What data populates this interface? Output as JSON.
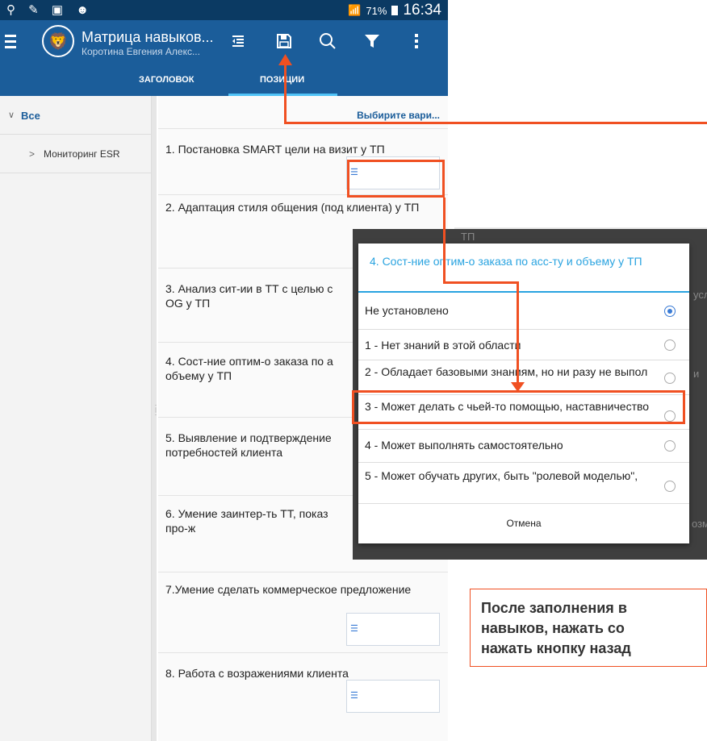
{
  "status_bar": {
    "left_icons": "⚲ ✎ ▣ ☻",
    "battery": "71%",
    "time": "16:34"
  },
  "app_bar": {
    "title": "Матрица навыков...",
    "subtitle": "Коротина Евгения Алекс...",
    "icons": [
      "menu-icon",
      "lion-logo",
      "collapse-icon",
      "save-icon",
      "search-icon",
      "filter-icon",
      "overflow-icon"
    ]
  },
  "tabs": [
    {
      "label": "ЗАГОЛОВОК"
    },
    {
      "label": "ПОЗИЦИИ",
      "active": true
    }
  ],
  "sidebar": {
    "items": [
      {
        "label": "Все",
        "expanded": true
      },
      {
        "label": "Мониторинг ESR",
        "expanded": false
      }
    ]
  },
  "content": {
    "choose_label": "Выбирите вари...",
    "questions": [
      "1. Постановка SMART цели на визит у ТП",
      "2. Адаптация стиля общения (под клиента) у ТП",
      "3. Анализ сит-ии в ТТ с целью с",
      "OG у ТП",
      "4. Сост-ние оптим-о заказа по а",
      "объему у ТП",
      "5. Выявление и подтверждение",
      "потребностей клиента",
      "6. Умение заинтер-ть ТТ, показ",
      "про-ж",
      "7.Умение сделать коммерческое предложение",
      "8. Работа с возражениями клиента"
    ]
  },
  "background_fragments": [
    "ТП",
    "усл",
    "и",
    "озм"
  ],
  "dialog": {
    "title": "4. Сост-ние оптим-о заказа по асс-ту и объему у ТП",
    "options": [
      {
        "label": "Не установлено",
        "selected": true
      },
      {
        "label": "1 - Нет знаний в этой области",
        "selected": false
      },
      {
        "label": "2 - Обладает базовыми знаниям, но ни разу не выпол",
        "selected": false
      },
      {
        "label": "3 - Может делать с чьей-то помощью, наставничество",
        "selected": false
      },
      {
        "label": "4 - Может выполнять самостоятельно",
        "selected": false
      },
      {
        "label": "5 - Может обучать других, быть \"ролевой моделью\",",
        "selected": false
      }
    ],
    "cancel_label": "Отмена"
  },
  "annotation": {
    "lines": [
      "После заполнения в",
      "навыков, нажать со",
      "нажать кнопку назад"
    ],
    "color": "#f05022"
  },
  "colors": {
    "app_bar": "#1b5d9a",
    "status_bar": "#0b3a63",
    "accent": "#29a3e0",
    "annotation": "#f05022"
  }
}
